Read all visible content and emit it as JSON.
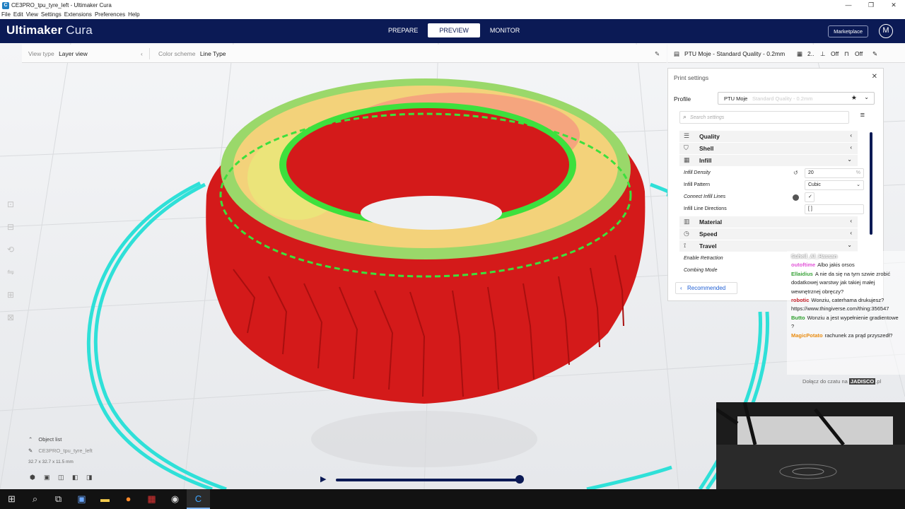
{
  "window": {
    "title": "CE3PRO_tpu_tyre_left - Ultimaker Cura",
    "controls": [
      "—",
      "❐",
      "✕"
    ]
  },
  "menu": [
    "File",
    "Edit",
    "View",
    "Settings",
    "Extensions",
    "Preferences",
    "Help"
  ],
  "header": {
    "brand_bold": "Ultimaker",
    "brand_light": "Cura",
    "stages": [
      "PREPARE",
      "PREVIEW",
      "MONITOR"
    ],
    "active_stage": "PREVIEW",
    "marketplace": "Marketplace",
    "avatar": "M"
  },
  "viewbar": {
    "view_type_label": "View type",
    "view_type_value": "Layer view",
    "color_scheme_label": "Color scheme",
    "color_scheme_value": "Line Type"
  },
  "print_bar": {
    "profile_summary": "PTU Moje - Standard Quality - 0.2mm",
    "infill_value": "2..",
    "support": "Off",
    "adhesion": "Off"
  },
  "panel": {
    "title": "Print settings",
    "profile_label": "Profile",
    "profile_name": "PTU Moje",
    "profile_quality": "Standard Quality - 0.2mm",
    "search_placeholder": "Search settings",
    "categories": {
      "quality": "Quality",
      "shell": "Shell",
      "infill": "Infill",
      "material": "Material",
      "speed": "Speed",
      "travel": "Travel"
    },
    "infill_density_label": "Infill Density",
    "infill_density_value": "20",
    "infill_density_unit": "%",
    "infill_pattern_label": "Infill Pattern",
    "infill_pattern_value": "Cubic",
    "connect_infill_label": "Connect Infill Lines",
    "connect_infill_value": "✓",
    "infill_directions_label": "Infill Line Directions",
    "infill_directions_value": "[ ]",
    "enable_retraction_label": "Enable Retraction",
    "combing_mode_label": "Combing Mode",
    "recommended": "Recommended"
  },
  "chat": {
    "messages": [
      {
        "user": "Suheil_Al_Hassan",
        "text": ""
      },
      {
        "user": "outoftime",
        "text": "Albo jakis orsos"
      },
      {
        "user": "Ellaidius",
        "text": "A nie da się na tym szwie zrobić dodatkowej warstwy jak takiej małej wewnętrznej obręczy?"
      },
      {
        "user": "robotic",
        "text": "Wonziu, caterhama drukujesz? https://www.thingiverse.com/thing:356547"
      },
      {
        "user": "Butto",
        "text": "Wonziu a jest wypełnienie gradientowe ?"
      },
      {
        "user": "MagicPotato",
        "text": "rachunek za prąd przyszedł?"
      }
    ],
    "footer_prefix": "Dołącz do czatu na",
    "footer_brand": "JADISCO",
    "footer_suffix": ".pl"
  },
  "object_list": {
    "label": "Object list",
    "object_name": "CE3PRO_tpu_tyre_left",
    "dimensions": "32.7 x 32.7 x 11.5 mm"
  }
}
